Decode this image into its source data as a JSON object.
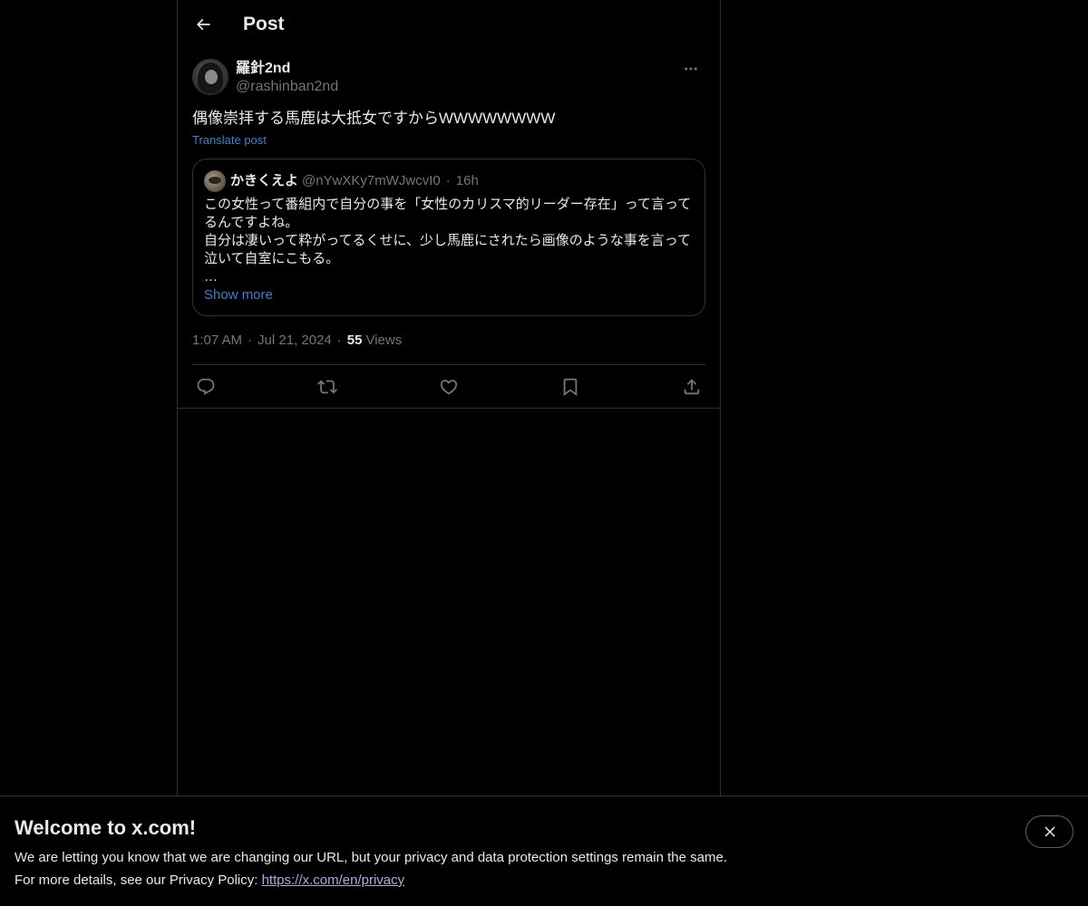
{
  "header": {
    "title": "Post",
    "back_icon": "arrow-left-icon"
  },
  "post": {
    "author_name": "羅針2nd",
    "author_handle": "@rashinban2nd",
    "text": "偶像崇拝する馬鹿は大抵女ですからWWWWWWWW",
    "translate_label": "Translate post",
    "more_icon": "more-horizontal-icon",
    "time": "1:07 AM",
    "date": "Jul 21, 2024",
    "views_count": "55",
    "views_label": "Views"
  },
  "quote": {
    "author_name": "かきくえよ",
    "author_handle": "@nYwXKy7mWJwcvI0",
    "time_ago": "16h",
    "lines": [
      "この女性って番組内で自分の事を「女性のカリスマ的リーダー存在」って言って",
      "るんですよね。",
      "自分は凄いって粋がってるくせに、少し馬鹿にされたら画像のような事を言って",
      "泣いて自室にこもる。",
      "…"
    ],
    "show_more_label": "Show more"
  },
  "actions": {
    "reply_icon": "reply-icon",
    "repost_icon": "repost-icon",
    "like_icon": "heart-icon",
    "bookmark_icon": "bookmark-icon",
    "share_icon": "share-icon"
  },
  "banner": {
    "title": "Welcome to x.com!",
    "line1": "We are letting you know that we are changing our URL, but your privacy and data protection settings remain the same.",
    "line2_prefix": "For more details, see our Privacy Policy: ",
    "privacy_link": "https://x.com/en/privacy",
    "close_icon": "close-icon"
  },
  "colors": {
    "background": "#000000",
    "text_primary": "#e7e9ea",
    "text_secondary": "#71767b",
    "link": "#4a7dbf",
    "border": "#2f3336",
    "privacy_link": "#b4a6e8"
  }
}
